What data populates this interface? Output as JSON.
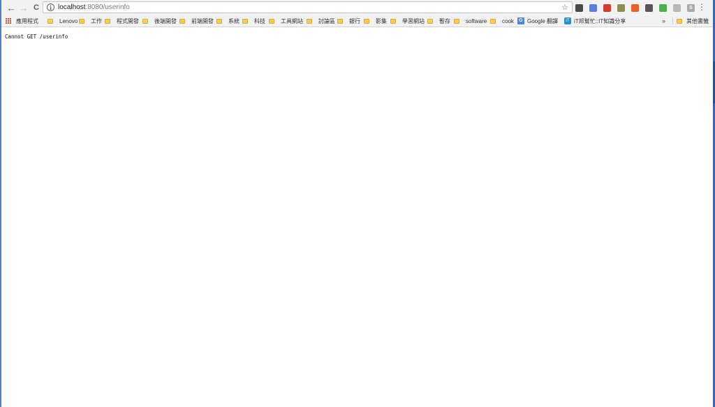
{
  "colors": {
    "toolbar_bg": "#f2f2f2",
    "folder": "#f5cf5b",
    "accent": "#2b68c9"
  },
  "toolbar": {
    "back_icon": "arrow-left-icon",
    "forward_icon": "arrow-right-icon",
    "reload_icon": "reload-icon",
    "back_glyph": "←",
    "forward_glyph": "→",
    "reload_glyph": "C",
    "url_host": "localhost",
    "url_rest": ":8080/userinfo",
    "star_glyph": "☆",
    "menu_glyph": "⋮"
  },
  "extensions": [
    {
      "name": "shield-extension-icon",
      "color": "#4a4a4a",
      "glyph": ""
    },
    {
      "name": "blue-extension-icon",
      "color": "#5b7fe0",
      "glyph": ""
    },
    {
      "name": "red-extension-icon",
      "color": "#d33b2c",
      "glyph": ""
    },
    {
      "name": "olive-extension-icon",
      "color": "#8f8f55",
      "glyph": ""
    },
    {
      "name": "orange-extension-icon",
      "color": "#e8602c",
      "glyph": ""
    },
    {
      "name": "dark-extension-icon",
      "color": "#555555",
      "glyph": ""
    },
    {
      "name": "green-extension-icon",
      "color": "#4caf50",
      "glyph": ""
    },
    {
      "name": "gray-extension-icon",
      "color": "#b8b8b8",
      "glyph": ""
    },
    {
      "name": "skype-extension-icon",
      "color": "#a9a9a9",
      "glyph": "S"
    }
  ],
  "bookmarks": {
    "apps_label": "應用程式",
    "items": [
      {
        "label": "Lenovo",
        "type": "folder"
      },
      {
        "label": "工作",
        "type": "folder"
      },
      {
        "label": "程式開發",
        "type": "folder"
      },
      {
        "label": "後端開發",
        "type": "folder"
      },
      {
        "label": "前端開發",
        "type": "folder"
      },
      {
        "label": "系統",
        "type": "folder"
      },
      {
        "label": "科技",
        "type": "folder"
      },
      {
        "label": "工具網站",
        "type": "folder"
      },
      {
        "label": "討論區",
        "type": "folder"
      },
      {
        "label": "銀行",
        "type": "folder"
      },
      {
        "label": "影集",
        "type": "folder"
      },
      {
        "label": "學習網站",
        "type": "folder"
      },
      {
        "label": "暫存",
        "type": "folder"
      },
      {
        "label": "software",
        "type": "folder"
      },
      {
        "label": "cook",
        "type": "folder"
      },
      {
        "label": "Google 翻譯",
        "type": "google-translate"
      },
      {
        "label": "iT邦幫忙::IT知識分享",
        "type": "ithome"
      }
    ],
    "more_glyph": "»",
    "other_label": "其他書籤"
  },
  "page": {
    "error_message": "Cannot GET /userinfo"
  }
}
